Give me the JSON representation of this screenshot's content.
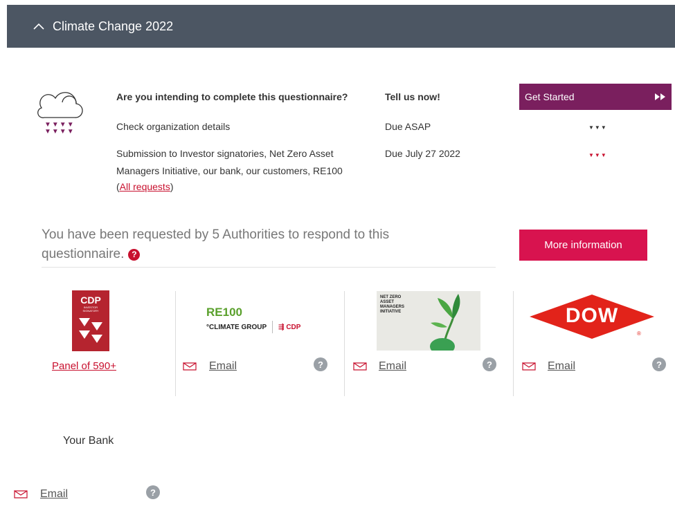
{
  "header": {
    "title": "Climate Change 2022"
  },
  "tasks": {
    "question": "Are you intending to complete this questionnaire?",
    "tell_us": "Tell us now!",
    "get_started": "Get Started",
    "check_org": "Check organization details",
    "due_asap": "Due ASAP",
    "submission_line1": "Submission to Investor signatories, Net Zero Asset",
    "submission_line2": "Managers Initiative, our bank, our customers, RE100",
    "all_requests_open": "(",
    "all_requests": "All requests",
    "all_requests_close": ")",
    "due_date": "Due July 27 2022"
  },
  "authorities": {
    "intro_line1": "You have been requested by 5 Authorities to respond to this",
    "intro_line2": "questionnaire.",
    "more_info": "More information",
    "panel_link": "Panel of 590+",
    "email_label": "Email",
    "your_bank": "Your Bank",
    "help_glyph": "?"
  },
  "logos": {
    "cdp_title": "CDP",
    "cdp_sub1": "INVESTOR",
    "cdp_sub2": "SIGNATORY",
    "re100_title": "RE100",
    "re100_climate": "°CLIMATE GROUP",
    "re100_cdp": "CDP",
    "nz_line1": "NET ZERO",
    "nz_line2": "ASSET",
    "nz_line3": "MANAGERS",
    "nz_line4": "INITIATIVE",
    "dow": "DOW",
    "dow_reg": "®"
  },
  "colors": {
    "header_bg": "#4c5663",
    "purple": "#7a1f5e",
    "red": "#d8134f",
    "cdp_red": "#b5242f"
  }
}
